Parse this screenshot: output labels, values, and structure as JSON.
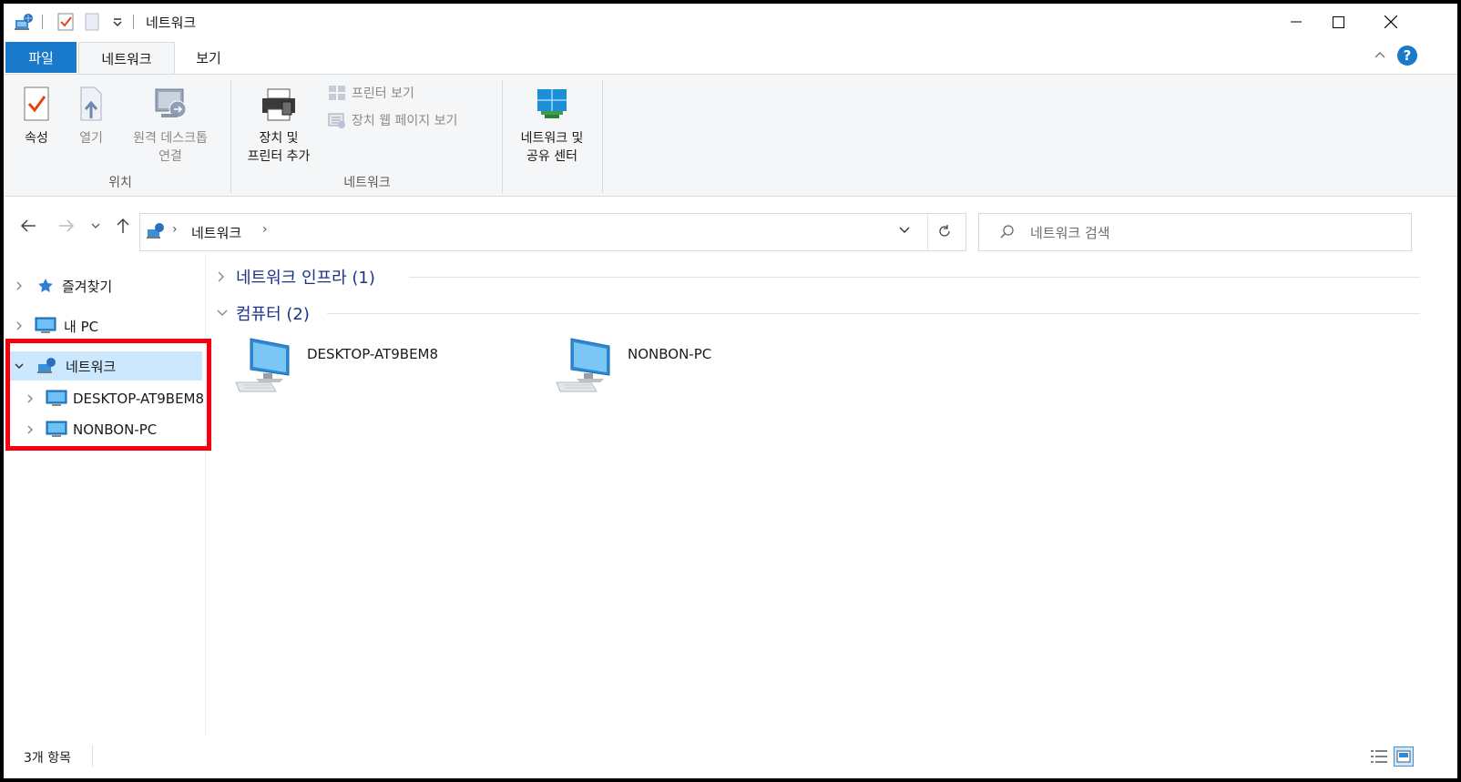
{
  "window": {
    "title": "네트워크",
    "minimize_glyph": "—",
    "maximize_glyph": "☐",
    "close_glyph": "✕"
  },
  "tabs": {
    "file": "파일",
    "network": "네트워크",
    "view": "보기"
  },
  "ribbon": {
    "properties": "속성",
    "open": "열기",
    "rdp_line1": "원격 데스크톱",
    "rdp_line2": "연결",
    "group_location": "위치",
    "add_device_line1": "장치 및",
    "add_device_line2": "프린터 추가",
    "view_printers": "프린터 보기",
    "view_device_web": "장치 웹 페이지 보기",
    "group_network": "네트워크",
    "network_center_line1": "네트워크 및",
    "network_center_line2": "공유 센터"
  },
  "address": {
    "path": "네트워크",
    "separator": "›"
  },
  "search": {
    "placeholder": "네트워크 검색"
  },
  "navpane": {
    "favorites": "즐겨찾기",
    "this_pc": "내 PC",
    "network": "네트워크",
    "children": [
      "DESKTOP-AT9BEM8",
      "NONBON-PC"
    ]
  },
  "content": {
    "group_infra": "네트워크 인프라 (1)",
    "group_computers": "컴퓨터 (2)",
    "computers": [
      "DESKTOP-AT9BEM8",
      "NONBON-PC"
    ]
  },
  "status": {
    "item_count": "3개 항목"
  },
  "colors": {
    "file_tab": "#1979ca",
    "selection": "#cce8ff",
    "highlight_box": "#f5000c",
    "group_header": "#1e3287"
  }
}
